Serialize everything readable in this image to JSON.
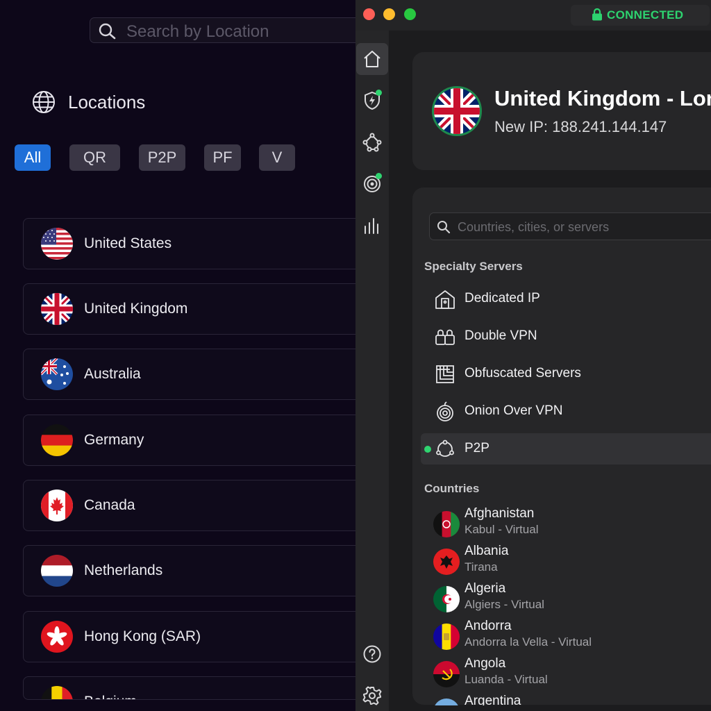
{
  "left": {
    "search_placeholder": "Search by Location",
    "title": "Locations",
    "filters": [
      "All",
      "QR",
      "P2P",
      "PF",
      "V"
    ],
    "active_filter": "All",
    "locations": [
      "United States",
      "United Kingdom",
      "Australia",
      "Germany",
      "Canada",
      "Netherlands",
      "Hong Kong (SAR)",
      "Belgium"
    ]
  },
  "window": {
    "status": "CONNECTED",
    "status_color": "#2dd36f"
  },
  "sidebar": {
    "icons": [
      "home-icon",
      "threat-protection-icon",
      "meshnet-icon",
      "dark-web-monitor-icon",
      "stats-icon",
      "help-icon",
      "settings-icon"
    ]
  },
  "connection": {
    "country": "United Kingdom - London",
    "ip_label": "New IP: 188.241.144.147"
  },
  "servers": {
    "search_placeholder": "Countries, cities, or servers",
    "specialty_heading": "Specialty Servers",
    "specialty": [
      "Dedicated IP",
      "Double VPN",
      "Obfuscated Servers",
      "Onion Over VPN",
      "P2P"
    ],
    "active_specialty": "P2P",
    "countries_heading": "Countries",
    "countries": [
      {
        "name": "Afghanistan",
        "city": "Kabul - Virtual"
      },
      {
        "name": "Albania",
        "city": "Tirana"
      },
      {
        "name": "Algeria",
        "city": "Algiers - Virtual"
      },
      {
        "name": "Andorra",
        "city": "Andorra la Vella - Virtual"
      },
      {
        "name": "Angola",
        "city": "Luanda - Virtual"
      },
      {
        "name": "Argentina",
        "city": ""
      }
    ]
  }
}
